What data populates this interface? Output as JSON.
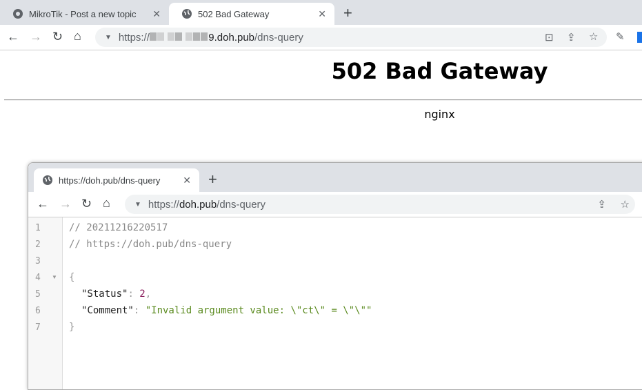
{
  "outer": {
    "tabs": [
      {
        "label": "MikroTik - Post a new topic",
        "icon": "mikrotik-icon"
      },
      {
        "label": "502 Bad Gateway",
        "icon": "globe-icon"
      }
    ],
    "url_prefix": "https://",
    "url_host": "9.doh.pub",
    "url_path": "/dns-query",
    "heading": "502 Bad Gateway",
    "server": "nginx"
  },
  "inner": {
    "tab": {
      "label": "https://doh.pub/dns-query",
      "icon": "globe-icon"
    },
    "url_prefix": "https://",
    "url_host": "doh.pub",
    "url_path": "/dns-query",
    "lines": [
      "1",
      "2",
      "3",
      "4",
      "5",
      "6",
      "7"
    ],
    "code": {
      "c1": "// 20211216220517",
      "c2": "// https://doh.pub/dns-query",
      "open": "{",
      "k1": "\"Status\"",
      "v1": "2",
      "k2": "\"Comment\"",
      "v2": "\"Invalid argument value: \\\"ct\\\" = \\\"\\\"\"",
      "close": "}",
      "colon": ": ",
      "comma": ","
    }
  }
}
